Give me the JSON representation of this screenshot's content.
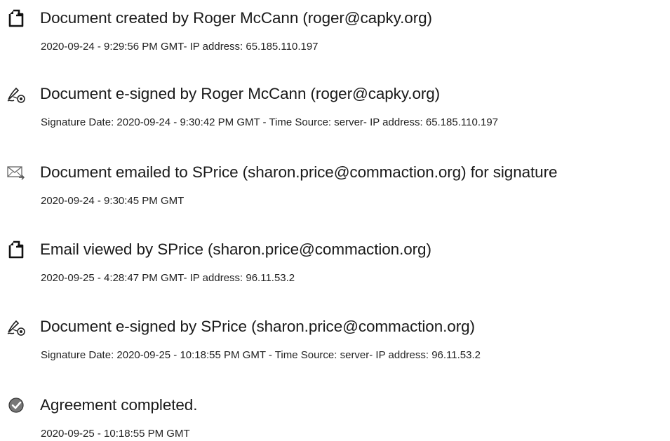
{
  "audit_events": [
    {
      "icon": "document-created-icon",
      "title": "Document created by Roger McCann (roger@capky.org)",
      "detail": "2020-09-24 - 9:29:56 PM GMT- IP address: 65.185.110.197"
    },
    {
      "icon": "e-sign-pen-icon",
      "title": "Document e-signed by Roger McCann (roger@capky.org)",
      "detail": "Signature Date: 2020-09-24 - 9:30:42 PM GMT - Time Source: server- IP address: 65.185.110.197"
    },
    {
      "icon": "email-sent-icon",
      "title": "Document emailed to SPrice (sharon.price@commaction.org) for signature",
      "detail": "2020-09-24 - 9:30:45 PM GMT"
    },
    {
      "icon": "email-viewed-icon",
      "title": "Email viewed by SPrice (sharon.price@commaction.org)",
      "detail": "2020-09-25 - 4:28:47 PM GMT- IP address: 96.11.53.2"
    },
    {
      "icon": "e-sign-pen-icon",
      "title": "Document e-signed by SPrice (sharon.price@commaction.org)",
      "detail": "Signature Date: 2020-09-25 - 10:18:55 PM GMT - Time Source: server- IP address: 96.11.53.2"
    },
    {
      "icon": "checkmark-badge-icon",
      "title": "Agreement completed.",
      "detail": "2020-09-25 - 10:18:55 PM GMT"
    }
  ]
}
